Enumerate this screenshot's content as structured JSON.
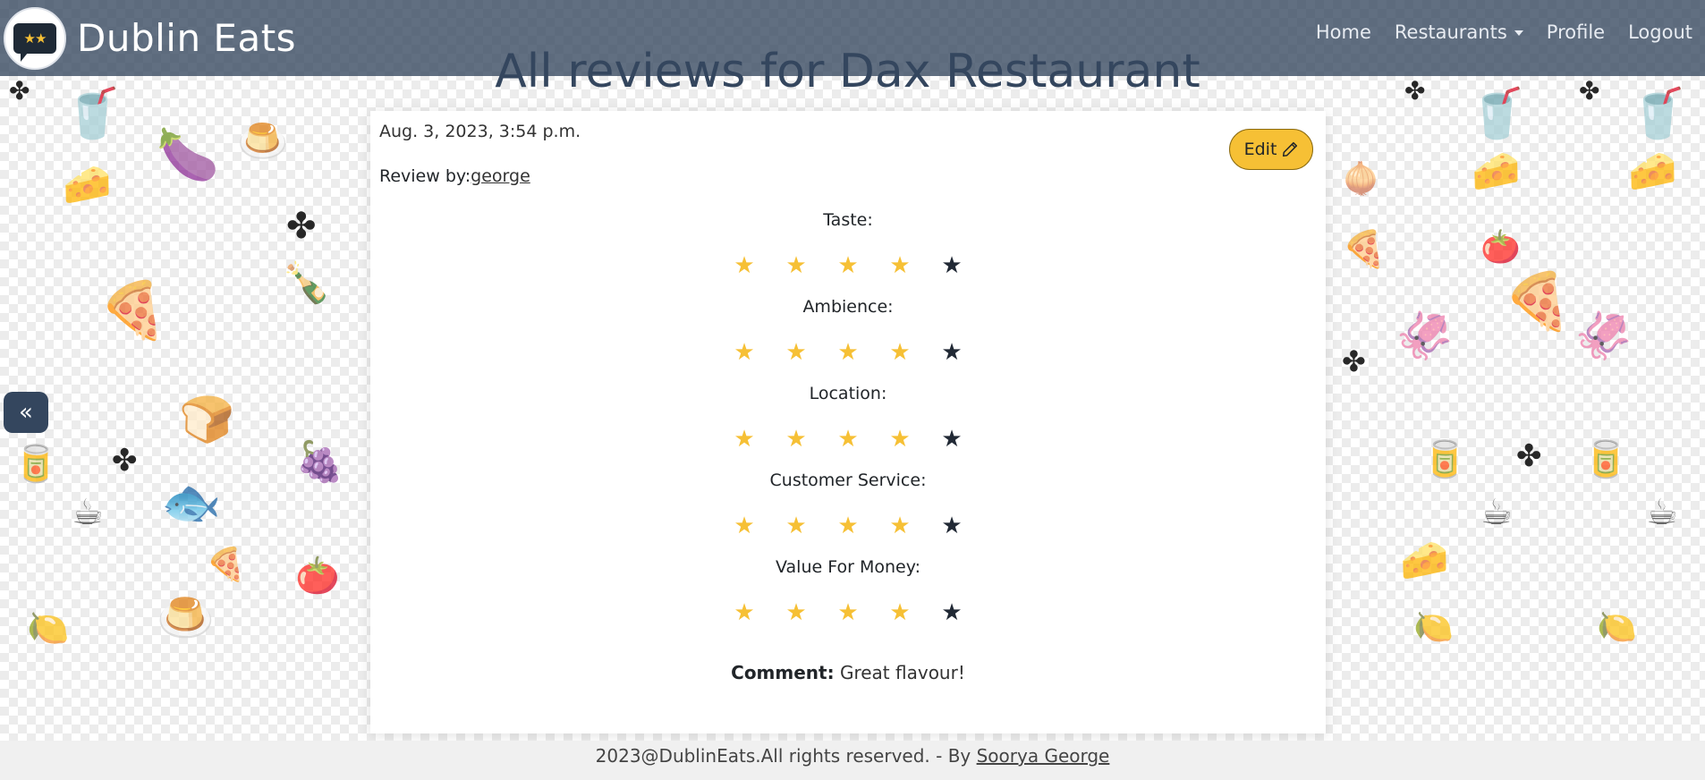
{
  "navbar": {
    "brand": "Dublin Eats",
    "logo_icon": "review-bubble-stars-icon",
    "links": {
      "home": "Home",
      "restaurants": "Restaurants",
      "profile": "Profile",
      "logout": "Logout"
    }
  },
  "page": {
    "title": "All reviews for Dax Restaurant"
  },
  "review": {
    "date": "Aug. 3, 2023, 3:54 p.m.",
    "by_label": "Review by:",
    "author": "george",
    "edit_label": "Edit",
    "edit_icon": "pencil-icon",
    "ratings": [
      {
        "label": "Taste:",
        "stars": 4,
        "max": 5
      },
      {
        "label": "Ambience:",
        "stars": 4,
        "max": 5
      },
      {
        "label": "Location:",
        "stars": 4,
        "max": 5
      },
      {
        "label": "Customer Service:",
        "stars": 4,
        "max": 5
      },
      {
        "label": "Value For Money:",
        "stars": 4,
        "max": 5
      }
    ],
    "comment_label": "Comment:",
    "comment_text": "Great flavour!"
  },
  "sidebar_toggle": {
    "icon": "double-chevron-left-icon",
    "glyph": "«"
  },
  "footer": {
    "text": "2023@DublinEats.All rights reserved. - By",
    "author_link": "Soorya George"
  },
  "colors": {
    "navbar_bg": "#34465e",
    "accent_yellow": "#f6c035",
    "star_empty": "#212935"
  }
}
